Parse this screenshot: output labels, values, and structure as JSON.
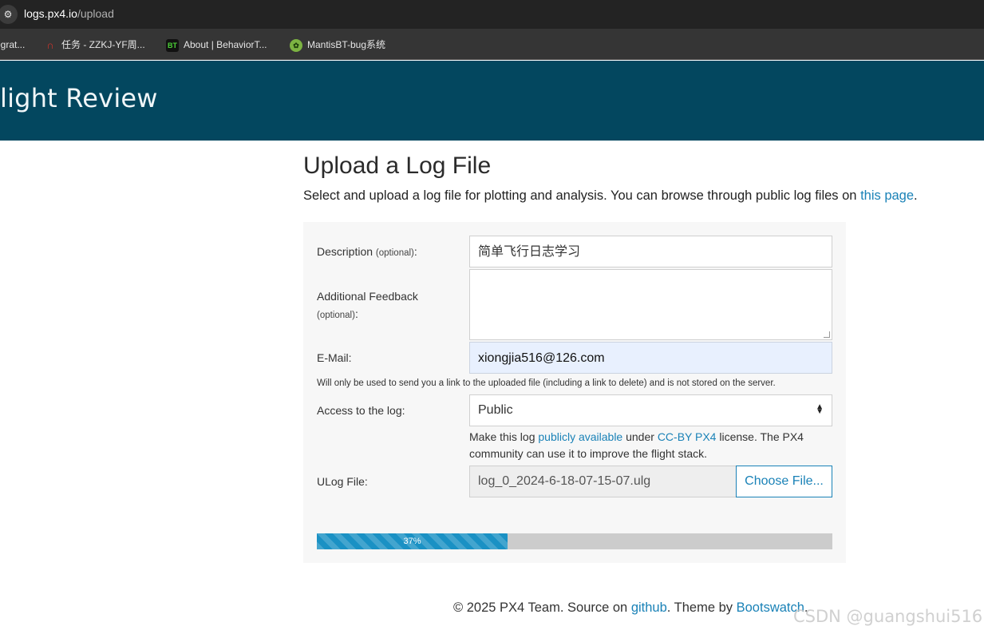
{
  "browser": {
    "url_host": "logs.px4.io",
    "url_path": "/upload",
    "bookmarks": [
      {
        "label": "egrat...",
        "icon": "bookmark-icon"
      },
      {
        "label": "任务 - ZZKJ-YF周...",
        "icon": "headset-icon"
      },
      {
        "label": "About | BehaviorT...",
        "icon": "bt-logo-icon"
      },
      {
        "label": "MantisBT-bug系统",
        "icon": "mantis-icon"
      }
    ]
  },
  "header": {
    "brand": "light Review",
    "background_color": "#03475f"
  },
  "main": {
    "title": "Upload a Log File",
    "intro_text": "Select and upload a log file for plotting and analysis. You can browse through public log files on ",
    "intro_link": "this page",
    "intro_end": "."
  },
  "form": {
    "description": {
      "label": "Description",
      "optional": "(optional)",
      "colon": ":",
      "value": "简单飞行日志学习"
    },
    "feedback": {
      "label": "Additional Feedback",
      "optional": "(optional)",
      "colon": ":",
      "value": ""
    },
    "email": {
      "label": "E-Mail:",
      "value": "xiongjia516@126.com",
      "note": "Will only be used to send you a link to the uploaded file (including a link to delete) and is not stored on the server."
    },
    "access": {
      "label": "Access to the log:",
      "selected": "Public",
      "help_prefix": "Make this log ",
      "help_link1": "publicly available",
      "help_mid": " under ",
      "help_link2": "CC-BY PX4",
      "help_suffix": " license. The PX4 community can use it to improve the flight stack."
    },
    "ulog": {
      "label": "ULog File:",
      "file_name": "log_0_2024-6-18-07-15-07.ulg",
      "button": "Choose File..."
    },
    "progress": {
      "percent": 37,
      "label": "37%"
    }
  },
  "footer": {
    "prefix": "© 2025 PX4 Team. Source on ",
    "link1": "github",
    "mid": ". Theme by ",
    "link2": "Bootswatch",
    "suffix": "."
  },
  "watermark": "CSDN @guangshui516",
  "colors": {
    "link": "#1a82b7",
    "progress": "#1a91c4"
  }
}
